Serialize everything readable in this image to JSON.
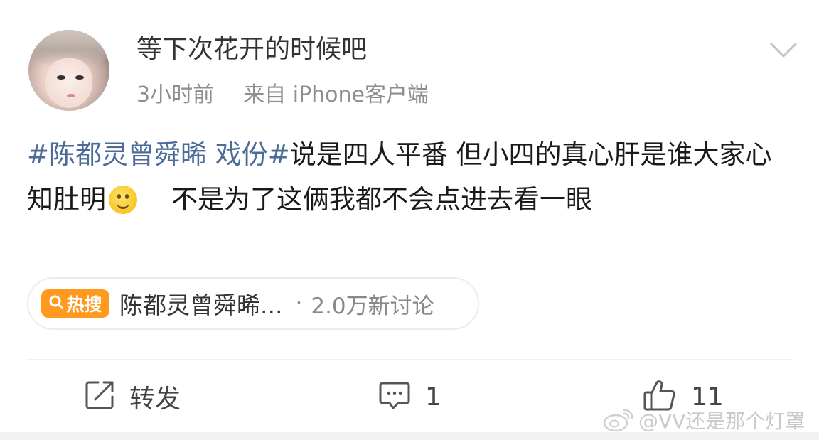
{
  "post": {
    "username": "等下次花开的时候吧",
    "time": "3小时前",
    "source_prefix": "来自",
    "source": "iPhone客户端",
    "hashtag": "#陈都灵曾舜晞 戏份#",
    "text_part1": "说是四人平番  但小四的真心肝是谁大家心知肚明",
    "text_part2": "不是为了这俩我都不会点进去看一眼"
  },
  "trend": {
    "badge": "热搜",
    "title": "陈都灵曾舜晞...",
    "separator": "·",
    "stat": "2.0万新讨论"
  },
  "actions": {
    "repost_label": "转发",
    "comment_count": "1",
    "like_count": "11"
  },
  "watermark": {
    "text": "@VV还是那个灯罩"
  },
  "colors": {
    "hashtag": "#4b6c96",
    "badge": "#ff9a1f",
    "meta": "#8e8e8e"
  },
  "icons": {
    "avatar": "user-avatar",
    "menu": "chevron-down-icon",
    "emoji": "smiley-emoji-icon",
    "trend": "search-icon",
    "repost": "repost-icon",
    "comment": "comment-icon",
    "like": "thumbs-up-icon",
    "watermark": "weibo-logo-icon"
  }
}
